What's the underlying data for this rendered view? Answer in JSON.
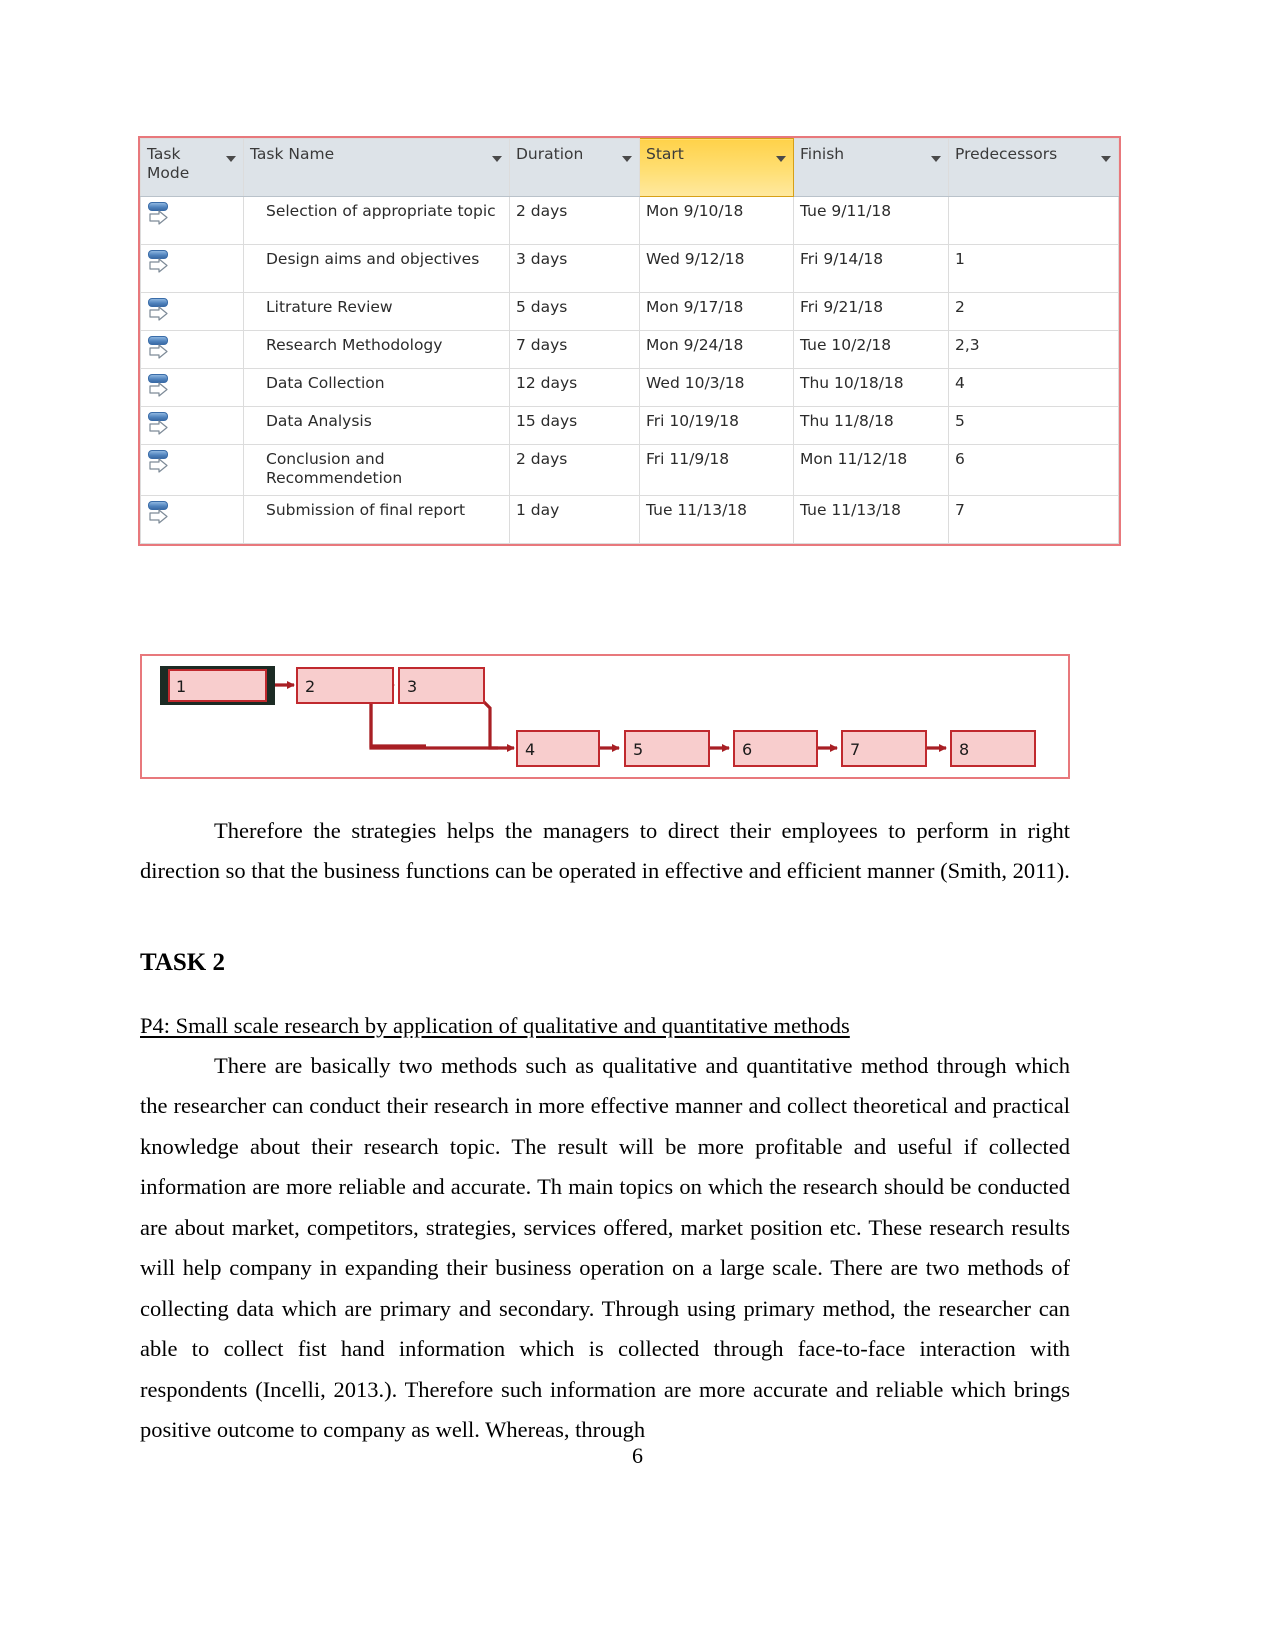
{
  "document": {
    "page_number": "6"
  },
  "project_table": {
    "columns": [
      {
        "label": "Task Mode",
        "highlighted": false
      },
      {
        "label": "Task Name",
        "highlighted": false
      },
      {
        "label": "Duration",
        "highlighted": false
      },
      {
        "label": "Start",
        "highlighted": true
      },
      {
        "label": "Finish",
        "highlighted": false
      },
      {
        "label": "Predecessors",
        "highlighted": false
      }
    ],
    "highlight_color": "#ffd24a",
    "border_color": "#e8787c",
    "header_background": "#dde3e8",
    "rows": [
      {
        "mode_icon": "manually-scheduled-task-icon",
        "name": "Selection of appropriate topic",
        "duration": "2 days",
        "start": "Mon 9/10/18",
        "finish": "Tue 9/11/18",
        "predecessors": ""
      },
      {
        "mode_icon": "manually-scheduled-task-icon",
        "name": "Design aims and objectives",
        "duration": "3 days",
        "start": "Wed 9/12/18",
        "finish": "Fri 9/14/18",
        "predecessors": "1"
      },
      {
        "mode_icon": "manually-scheduled-task-icon",
        "name": "Litrature Review",
        "duration": "5 days",
        "start": "Mon 9/17/18",
        "finish": "Fri 9/21/18",
        "predecessors": "2"
      },
      {
        "mode_icon": "manually-scheduled-task-icon",
        "name": "Research Methodology",
        "duration": "7 days",
        "start": "Mon 9/24/18",
        "finish": "Tue 10/2/18",
        "predecessors": "2,3"
      },
      {
        "mode_icon": "manually-scheduled-task-icon",
        "name": "Data Collection",
        "duration": "12 days",
        "start": "Wed 10/3/18",
        "finish": "Thu 10/18/18",
        "predecessors": "4"
      },
      {
        "mode_icon": "manually-scheduled-task-icon",
        "name": "Data Analysis",
        "duration": "15 days",
        "start": "Fri 10/19/18",
        "finish": "Thu 11/8/18",
        "predecessors": "5"
      },
      {
        "mode_icon": "manually-scheduled-task-icon",
        "name": "Conclusion and Recommendetion",
        "duration": "2 days",
        "start": "Fri 11/9/18",
        "finish": "Mon 11/12/18",
        "predecessors": "6"
      },
      {
        "mode_icon": "manually-scheduled-task-icon",
        "name": "Submission of final report",
        "duration": "1 day",
        "start": "Tue 11/13/18",
        "finish": "Tue 11/13/18",
        "predecessors": "7"
      }
    ]
  },
  "network_diagram": {
    "node_fill": "#f8cdcd",
    "node_stroke": "#c0292e",
    "link_color": "#a81f24",
    "nodes": [
      {
        "id": "1",
        "label": "1",
        "selected": true
      },
      {
        "id": "2",
        "label": "2",
        "selected": false
      },
      {
        "id": "3",
        "label": "3",
        "selected": false
      },
      {
        "id": "4",
        "label": "4",
        "selected": false
      },
      {
        "id": "5",
        "label": "5",
        "selected": false
      },
      {
        "id": "6",
        "label": "6",
        "selected": false
      },
      {
        "id": "7",
        "label": "7",
        "selected": false
      },
      {
        "id": "8",
        "label": "8",
        "selected": false
      }
    ],
    "links": [
      {
        "from": "1",
        "to": "2"
      },
      {
        "from": "2",
        "to": "3"
      },
      {
        "from": "2",
        "to": "4"
      },
      {
        "from": "3",
        "to": "4"
      },
      {
        "from": "4",
        "to": "5"
      },
      {
        "from": "5",
        "to": "6"
      },
      {
        "from": "6",
        "to": "7"
      },
      {
        "from": "7",
        "to": "8"
      }
    ]
  },
  "content": {
    "paragraph_after_figure": "Therefore the strategies helps the managers to direct their employees to perform in right direction so that the business functions can be operated in effective and efficient manner (Smith, 2011).",
    "task_heading": "TASK 2",
    "p4_heading": "P4: Small scale research by application of qualitative and quantitative methods",
    "main_paragraph": "There are basically two methods such as qualitative and quantitative method through which the researcher can conduct their research in more effective manner and collect theoretical and practical knowledge about their research topic. The result will be more profitable and useful if collected information are more reliable and accurate. Th main topics on which the research should be conducted are about market, competitors, strategies, services offered, market position etc. These research results will help company in expanding their business operation on a large scale. There are two methods of collecting data which are primary and secondary. Through using primary method, the researcher can able to collect fist hand information which is collected through face-to-face interaction with respondents (Incelli, 2013.). Therefore such information are more accurate and reliable which brings positive outcome to company as well. Whereas, through"
  }
}
